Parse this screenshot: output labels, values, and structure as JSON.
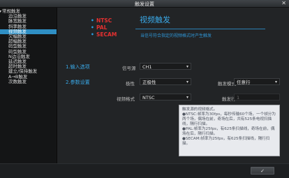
{
  "window": {
    "title": "触发设置",
    "close_glyph": "✕"
  },
  "sidebar": {
    "items": [
      {
        "label": "常规触发",
        "root": true
      },
      {
        "label": "边沿触发"
      },
      {
        "label": "脉宽触发"
      },
      {
        "label": "斜率触发"
      },
      {
        "label": "视频触发",
        "selected": true
      },
      {
        "label": "欠幅触发"
      },
      {
        "label": "超幅触发"
      },
      {
        "label": "码型触发"
      },
      {
        "label": "码型触发"
      },
      {
        "label": "N边沿触发"
      },
      {
        "label": "延迟触发"
      },
      {
        "label": "超时触发"
      },
      {
        "label": "建立/保持触发"
      },
      {
        "label": "A→B触发"
      },
      {
        "label": "次数触发"
      }
    ]
  },
  "main": {
    "standards": [
      "NTSC",
      "PAL",
      "SECAM"
    ],
    "title": "视频触发",
    "description": "当信号符合指定的视频格式时产生触发",
    "input_section": "1.输入选项",
    "param_section": "2.参数设置",
    "source_label": "信号源",
    "source_value": "CH1",
    "polarity_label": "极性",
    "polarity_value": "正极性",
    "trigger_mode_label": "触发模式",
    "trigger_mode_value": "任意行",
    "video_format_label": "视频格式",
    "video_format_value": "NTSC",
    "trigger_line_label": "触发行",
    "trigger_line_value": "1",
    "arrow_glyph": "▾"
  },
  "tooltip": {
    "lines": [
      "触发源的视频格式。",
      "●NTSC:帧率为30fps，每秒传输60个场，一个帧分为两个场，偶场在前，奇场在后，共有525条电视扫描线，隔行扫描。",
      "●PAL:帧率为25fps，有625条扫描线，奇场在前，偶场在后，隔行扫描。",
      "●SECAM:帧率为25fps，有625条扫描线，隔行扫描。"
    ]
  },
  "footer": {
    "ok_glyph": "✓"
  }
}
